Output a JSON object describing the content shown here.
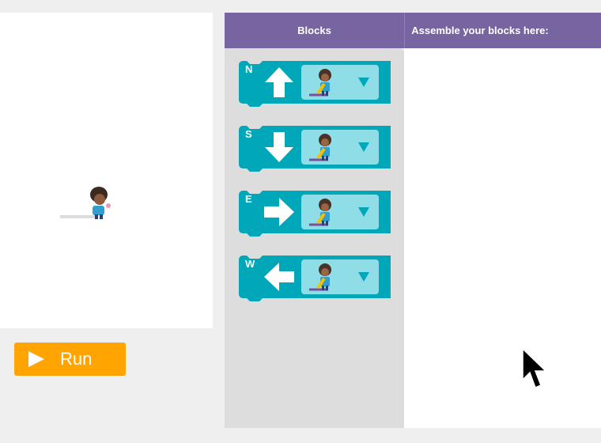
{
  "header": {
    "blocks_title": "Blocks",
    "workspace_title": "Assemble your blocks here:"
  },
  "run_button": {
    "label": "Run"
  },
  "blocks": [
    {
      "direction": "N",
      "arrow": "arrow-up-icon",
      "dropdown": "artist-pen-icon"
    },
    {
      "direction": "S",
      "arrow": "arrow-down-icon",
      "dropdown": "artist-pen-icon"
    },
    {
      "direction": "E",
      "arrow": "arrow-right-icon",
      "dropdown": "artist-pen-icon"
    },
    {
      "direction": "W",
      "arrow": "arrow-left-icon",
      "dropdown": "artist-pen-icon"
    }
  ],
  "colors": {
    "header": "#7665a0",
    "block": "#00a7b9",
    "dropdown": "#8fdde6",
    "run": "#ffa400"
  }
}
